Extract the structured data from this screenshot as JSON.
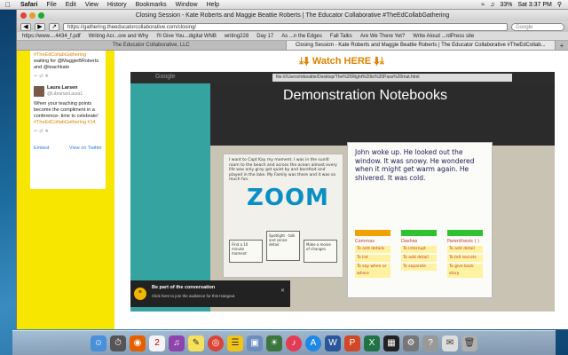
{
  "menubar": {
    "apple": "",
    "items": [
      "Safari",
      "File",
      "Edit",
      "View",
      "History",
      "Bookmarks",
      "Window",
      "Help"
    ],
    "status": {
      "battery": "33%",
      "clock": "Sat 3:37 PM"
    }
  },
  "window": {
    "title": "Closing Session - Kate Roberts and Maggie Beattie Roberts | The Educator Collaborative #TheEdCollabGathering",
    "url": "https://gathering.theeducatorcollaborative.com/closing/",
    "search_placeholder": "Google",
    "bookmarks": [
      "https://www....4434_f.pdf",
      "Writing Acr...ore and Why",
      "I'll Give You...digital WNB",
      "writing228",
      "Day 17",
      "As ...n the Edges",
      "Fall Talks",
      "Are We There Yet?",
      "Write Aloud ...rdPress site"
    ],
    "tabs": [
      {
        "label": "The Educator Collaborative, LLC",
        "active": false
      },
      {
        "label": "Closing Session - Kate Roberts and Maggie Beattie Roberts | The Educator Collaborative #TheEdCollab...",
        "active": true
      }
    ]
  },
  "sidebar": {
    "tweet1_lines": [
      "#TheEdCollabGathering",
      "waiting for @MaggieBRoberts",
      "and @teachkate"
    ],
    "tweet2": {
      "name": "Laura Larsen",
      "handle": "@LibrarianLaura1",
      "body": "When your teaching points become the compliment in a conference- time to celebrate!",
      "hashtag": "#TheEdCollabGathering #14"
    },
    "embed_label": "Embed",
    "twitter_label": "View on Twitter"
  },
  "main": {
    "watch_label": "Watch HERE"
  },
  "video": {
    "google_label": "Google",
    "inner_url": "file:///Users/mbeattie/Desktop/The%20Right%20to%20Pass%20mat.html",
    "slide_title": "Demonstration Notebooks",
    "zoom_chart": {
      "note": "I want to Capt Kay my moment. I was in the sunlit room to the beach and across the ocean almost every life was only gray got quiet by and barefoot and played in the lake. My Family was there and it was so much fun.",
      "word": "ZOOM",
      "box1": "Find a 10 minute moment",
      "box2": "Spotlight - talk and sense detail",
      "box3": "Make a movie of changes"
    },
    "john_chart": {
      "text": "John woke up. He looked out the window. It was snowy. He wondered when it might get warm again. He shivered. It was cold.",
      "columns": [
        {
          "title": "Commas",
          "lines": [
            "To add details",
            "To list",
            "To say when or where"
          ],
          "color": "#f2a200"
        },
        {
          "title": "Dashes",
          "lines": [
            "To interrupt",
            "To add detail",
            "To separate"
          ],
          "color": "#2fc22f"
        },
        {
          "title": "Parenthesis ( )",
          "lines": [
            "To add detail",
            "To tell secrets",
            "To give back story"
          ],
          "color": "#2fc22f"
        }
      ]
    },
    "toast": {
      "title": "Be part of the conversation",
      "subtitle": "Click here to join the audience for this Hangout"
    }
  },
  "dock": {
    "icons": [
      "finder-icon",
      "dashboard-icon",
      "firefox-icon",
      "calendar-icon",
      "itunes-icon",
      "stickies-icon",
      "chrome-icon",
      "notes-icon",
      "preview-icon",
      "photos-icon",
      "music-icon",
      "appstore-icon",
      "word-icon",
      "powerpoint-icon",
      "excel-icon",
      "terminal-icon",
      "scripts-icon",
      "help-icon",
      "mail-icon",
      "trash-icon"
    ]
  }
}
